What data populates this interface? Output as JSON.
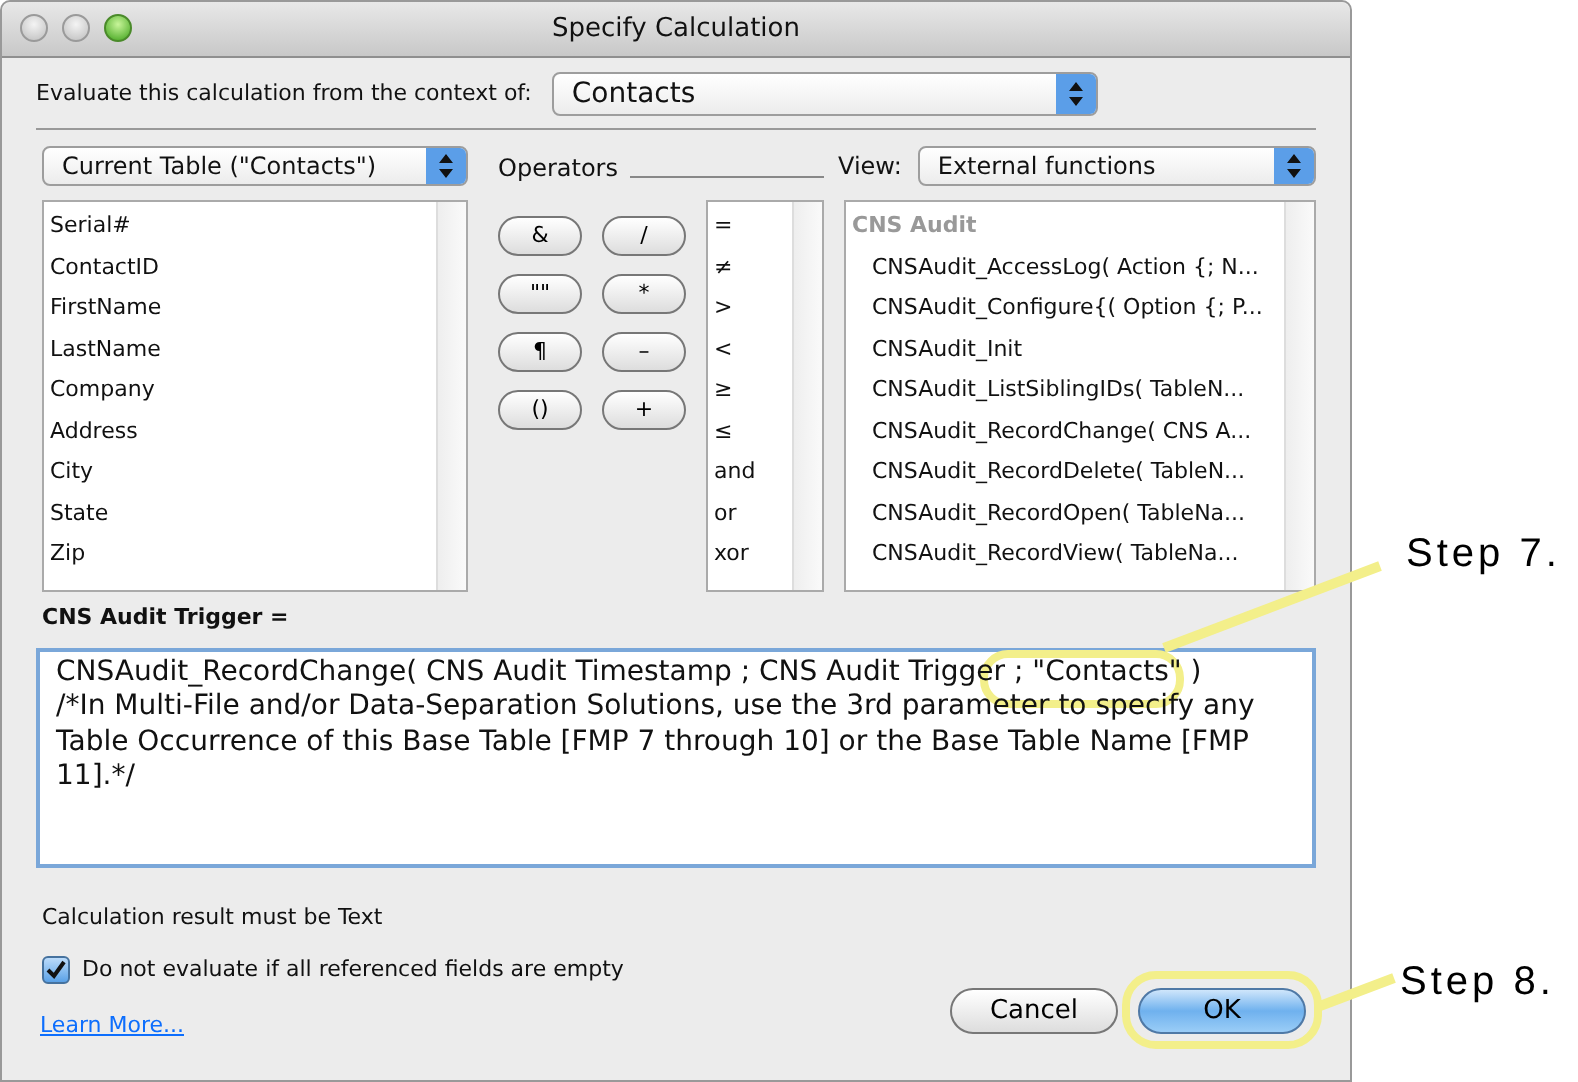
{
  "window": {
    "title": "Specify Calculation"
  },
  "context": {
    "label": "Evaluate this calculation from the context of:",
    "value": "Contacts"
  },
  "table_select": {
    "value": "Current Table (\"Contacts\")"
  },
  "fields": [
    "Serial#",
    "ContactID",
    "FirstName",
    "LastName",
    "Company",
    "Address",
    "City",
    "State",
    "Zip"
  ],
  "operators": {
    "label": "Operators",
    "buttons": [
      "&",
      "/",
      "\"\"",
      "*",
      "¶",
      "–",
      "()",
      "+"
    ],
    "list": [
      "=",
      "≠",
      ">",
      "<",
      "≥",
      "≤",
      "and",
      "or",
      "xor"
    ]
  },
  "view": {
    "label": "View:",
    "value": "External functions"
  },
  "functions": [
    {
      "kind": "header",
      "text": "CNS Audit"
    },
    {
      "kind": "item",
      "text": "CNSAudit_AccessLog( Action {; N..."
    },
    {
      "kind": "item",
      "text": "CNSAudit_Configure{( Option {; P..."
    },
    {
      "kind": "item",
      "text": "CNSAudit_Init"
    },
    {
      "kind": "item",
      "text": "CNSAudit_ListSiblingIDs( TableN..."
    },
    {
      "kind": "item",
      "text": "CNSAudit_RecordChange( CNS A..."
    },
    {
      "kind": "item",
      "text": "CNSAudit_RecordDelete( TableN..."
    },
    {
      "kind": "item",
      "text": "CNSAudit_RecordOpen( TableNa..."
    },
    {
      "kind": "item",
      "text": "CNSAudit_RecordView( TableNa..."
    }
  ],
  "formula": {
    "label": "CNS Audit Trigger =",
    "text": "CNSAudit_RecordChange( CNS Audit Timestamp ; CNS Audit Trigger ; \"Contacts\" )\n/*In Multi-File and/or Data-Separation Solutions, use the 3rd parameter to specify any Table Occurrence of this Base Table [FMP 7 through 10] or the Base Table Name [FMP 11].*/"
  },
  "result_note": "Calculation result must be Text",
  "checkbox": {
    "label": "Do not evaluate if all referenced fields are empty",
    "checked": true
  },
  "link": "Learn More...",
  "buttons": [
    {
      "label": "Cancel",
      "default": false
    },
    {
      "label": "OK",
      "default": true
    }
  ],
  "annotations": [
    {
      "label": "Step 7."
    },
    {
      "label": "Step 8."
    }
  ]
}
